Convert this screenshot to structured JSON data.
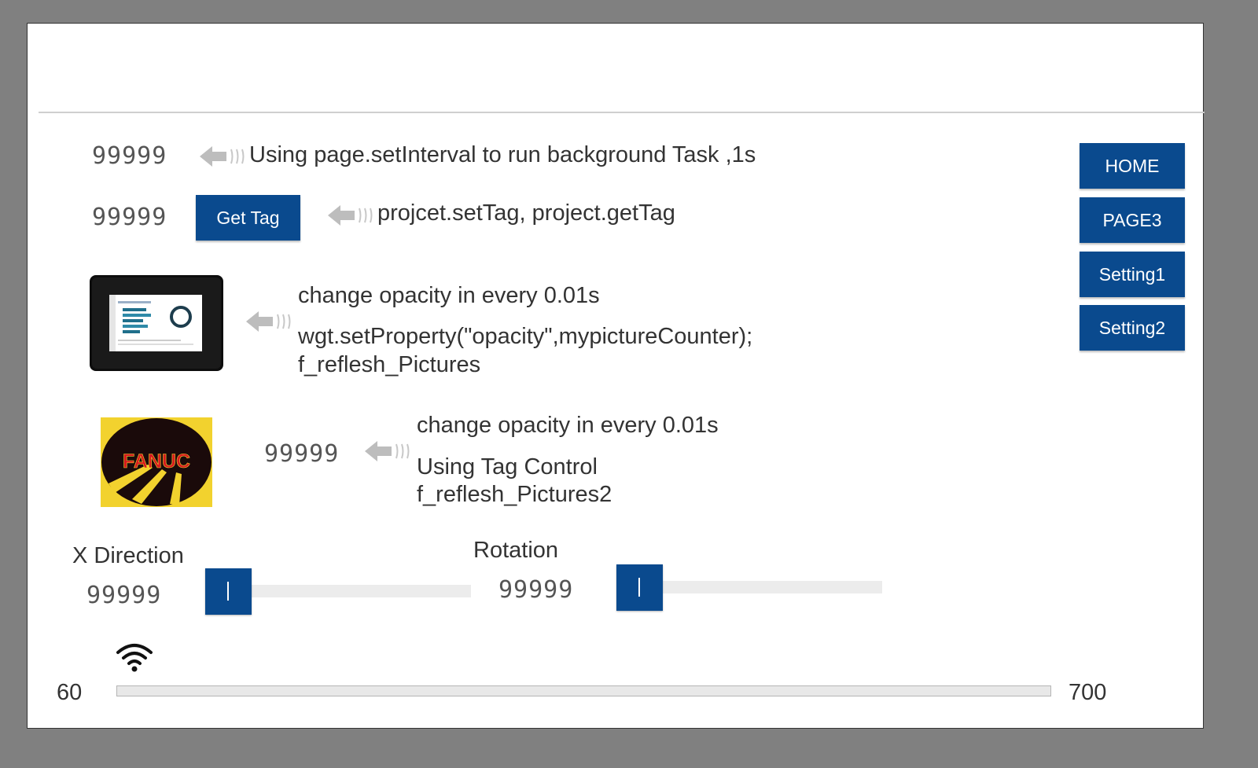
{
  "row1": {
    "value": "99999",
    "label": "Using page.setInterval to run background Task ,1s"
  },
  "row2": {
    "value": "99999",
    "button": "Get Tag",
    "label": "projcet.setTag, project.getTag"
  },
  "row3": {
    "line1": "change opacity in every 0.01s",
    "line2": "wgt.setProperty(\"opacity\",mypictureCounter);",
    "line3": "f_reflesh_Pictures"
  },
  "row4": {
    "logo": "FANUC",
    "value": "99999",
    "line1": "change opacity in every 0.01s",
    "line2": "Using Tag Control",
    "line3": "f_reflesh_Pictures2"
  },
  "x_direction": {
    "label": "X Direction",
    "value": "99999",
    "slider_level": 0
  },
  "rotation": {
    "label": "Rotation",
    "value": "99999",
    "slider_level": 0
  },
  "signal": {
    "icon": "wifi-icon",
    "min": "60",
    "max": "700",
    "level": 0
  },
  "nav": [
    {
      "label": "HOME"
    },
    {
      "label": "PAGE3"
    },
    {
      "label": "Setting1"
    },
    {
      "label": "Setting2"
    }
  ],
  "colors": {
    "accent": "#0a4a8e",
    "logo_yellow": "#f2d22e",
    "logo_red": "#d7191f"
  }
}
